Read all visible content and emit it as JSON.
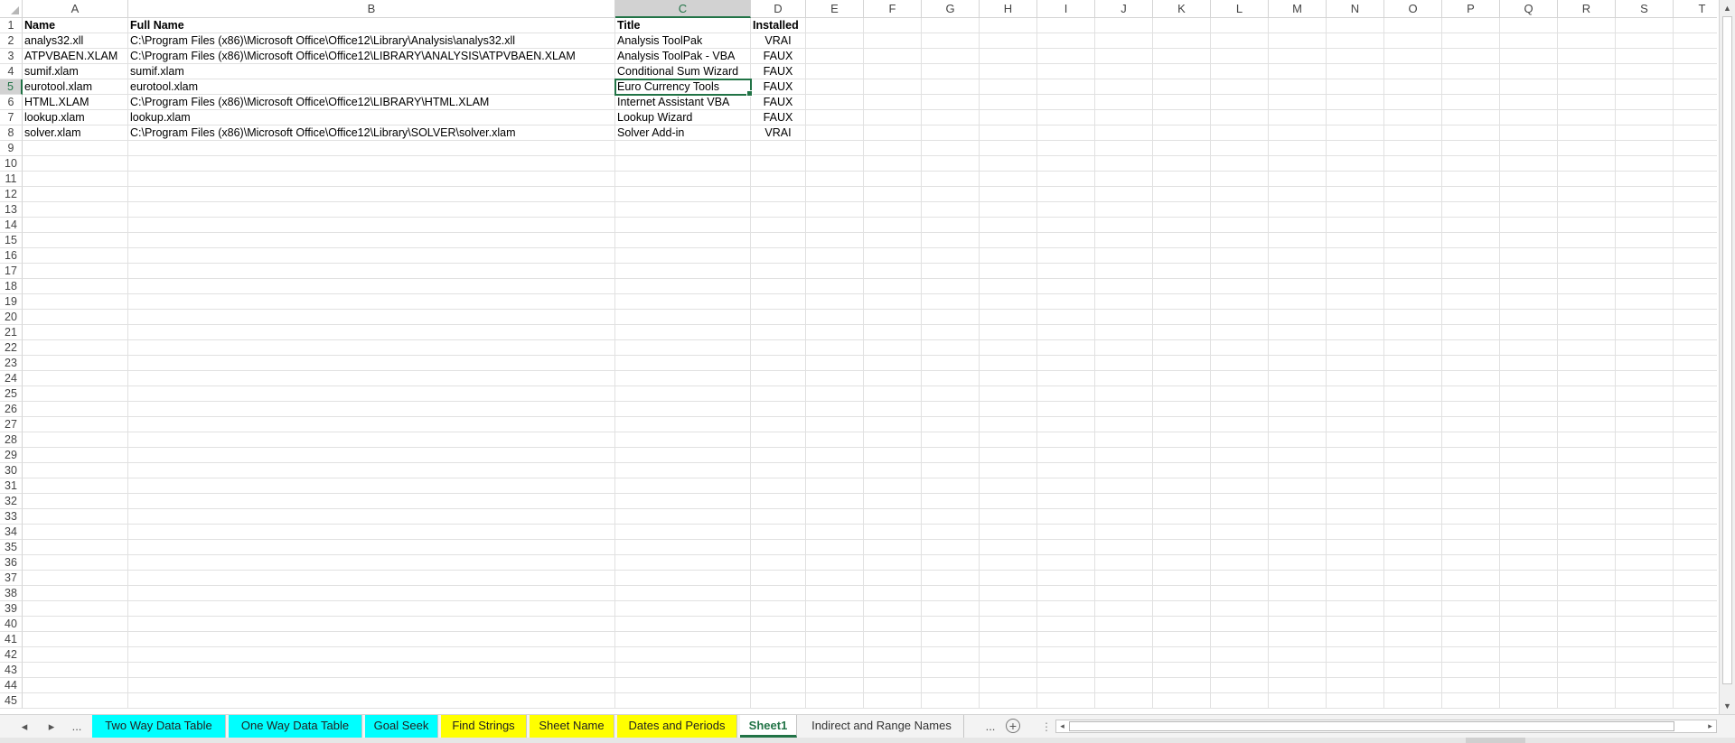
{
  "columns": [
    "A",
    "B",
    "C",
    "D",
    "E",
    "F",
    "G",
    "H",
    "I",
    "J",
    "K",
    "L",
    "M",
    "N",
    "O",
    "P",
    "Q",
    "R",
    "S",
    "T"
  ],
  "selected_column": "C",
  "selected_row": 5,
  "row_numbers": [
    1,
    2,
    3,
    4,
    5,
    6,
    7,
    8,
    9,
    10,
    11,
    12,
    13,
    14,
    15,
    16,
    17,
    18,
    19,
    20,
    21,
    22,
    23,
    24,
    25,
    26,
    27,
    28,
    29,
    30,
    31,
    32,
    33,
    34,
    35,
    36,
    37,
    38,
    39,
    40,
    41,
    42,
    43,
    44,
    45
  ],
  "header_row": {
    "name": "Name",
    "full_name": "Full Name",
    "title": "Title",
    "installed": "Installed"
  },
  "rows": [
    {
      "name": "analys32.xll",
      "full_name": "C:\\Program Files (x86)\\Microsoft Office\\Office12\\Library\\Analysis\\analys32.xll",
      "title": "Analysis ToolPak",
      "installed": "VRAI"
    },
    {
      "name": "ATPVBAEN.XLAM",
      "full_name": "C:\\Program Files (x86)\\Microsoft Office\\Office12\\LIBRARY\\ANALYSIS\\ATPVBAEN.XLAM",
      "title": "Analysis ToolPak - VBA",
      "installed": "FAUX"
    },
    {
      "name": "sumif.xlam",
      "full_name": "sumif.xlam",
      "title": "Conditional Sum Wizard",
      "installed": "FAUX"
    },
    {
      "name": "eurotool.xlam",
      "full_name": "eurotool.xlam",
      "title": "Euro Currency Tools",
      "installed": "FAUX"
    },
    {
      "name": "HTML.XLAM",
      "full_name": "C:\\Program Files (x86)\\Microsoft Office\\Office12\\LIBRARY\\HTML.XLAM",
      "title": "Internet Assistant VBA",
      "installed": "FAUX"
    },
    {
      "name": "lookup.xlam",
      "full_name": "lookup.xlam",
      "title": "Lookup Wizard",
      "installed": "FAUX"
    },
    {
      "name": "solver.xlam",
      "full_name": "C:\\Program Files (x86)\\Microsoft Office\\Office12\\Library\\SOLVER\\solver.xlam",
      "title": "Solver Add-in",
      "installed": "VRAI"
    }
  ],
  "sheet_tabs": [
    {
      "label": "Two Way Data Table",
      "color": "#00ffff",
      "active": false
    },
    {
      "label": "One Way Data Table",
      "color": "#00ffff",
      "active": false
    },
    {
      "label": "Goal Seek",
      "color": "#00ffff",
      "active": false
    },
    {
      "label": "Find Strings",
      "color": "#ffff00",
      "active": false
    },
    {
      "label": "Sheet Name",
      "color": "#ffff00",
      "active": false
    },
    {
      "label": "Dates and Periods",
      "color": "#ffff00",
      "active": false
    },
    {
      "label": "Sheet1",
      "color": "#ffffff",
      "active": true
    },
    {
      "label": "Indirect and Range Names",
      "color": "#f3f3f3",
      "active": false
    }
  ],
  "tab_nav": {
    "prev": "◂",
    "next": "▸",
    "more_left": "...",
    "more_right": "..."
  },
  "accent_color": "#217346"
}
